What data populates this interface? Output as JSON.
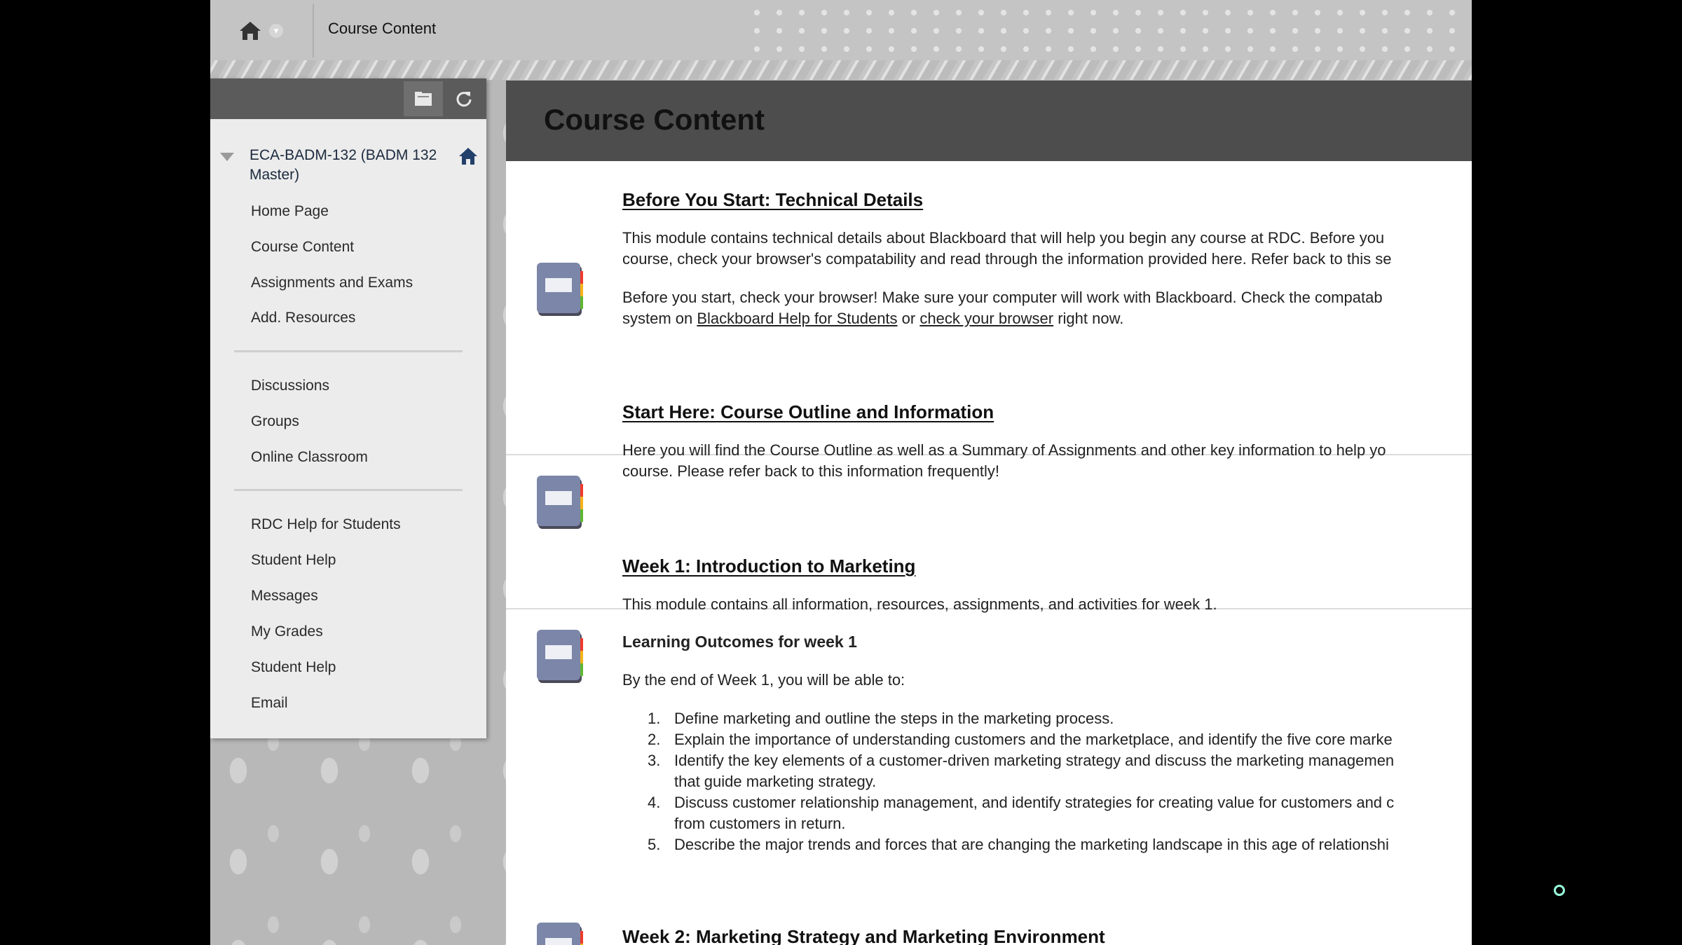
{
  "breadcrumb": {
    "current": "Course Content"
  },
  "sidebar": {
    "course_title": "ECA-BADM-132 (BADM 132 Master)",
    "group1": [
      "Home Page",
      "Course Content",
      "Assignments and Exams",
      "Add. Resources"
    ],
    "group2": [
      "Discussions",
      "Groups",
      "Online Classroom"
    ],
    "group3": [
      "RDC Help for Students",
      "Student Help",
      "Messages",
      "My Grades",
      "Student Help",
      "Email"
    ]
  },
  "main": {
    "title": "Course Content",
    "items": [
      {
        "title": "Before You Start: Technical Details",
        "p1_line1": "This module contains technical details about Blackboard that will help you begin any course at RDC. Before you",
        "p1_line2": "course, check your browser's compatability and read through the information provided here. Refer back to this se",
        "p2_line1": "Before you start, check your browser! Make sure your computer will work with Blackboard. Check the compatab",
        "p2_line2_pre": "system on ",
        "link1": "Blackboard Help for Students",
        "p2_line2_mid": " or ",
        "link2": "check your browser",
        "p2_line2_post": " right now."
      },
      {
        "title": "Start Here: Course Outline and Information",
        "p1_line1": "Here you will find the Course Outline as well as a Summary of Assignments and other key information to help yo",
        "p1_line2": "course. Please refer back to this information frequently!"
      },
      {
        "title": "Week 1: Introduction to Marketing",
        "p1_line1": "This module contains all information, resources, assignments, and activities for week 1.",
        "outcomes_title": "Learning Outcomes for week 1",
        "outcomes_intro": "By the end of Week 1, you will be able to:",
        "outcomes": [
          {
            "num": "1.",
            "lines": [
              "Define marketing and outline the steps in the marketing process."
            ]
          },
          {
            "num": "2.",
            "lines": [
              "Explain the importance of understanding customers and the marketplace, and identify the five core marke"
            ]
          },
          {
            "num": "3.",
            "lines": [
              "Identify the key elements of a customer-driven marketing strategy and discuss the marketing managemen",
              "that guide marketing strategy."
            ]
          },
          {
            "num": "4.",
            "lines": [
              "Discuss customer relationship management, and identify strategies for creating value for customers and c",
              "from customers in return."
            ]
          },
          {
            "num": "5.",
            "lines": [
              "Describe the major trends and forces that are changing the marketing landscape in this age of relationshi"
            ]
          }
        ]
      },
      {
        "title": "Week 2: Marketing Strategy and Marketing Environment"
      }
    ]
  }
}
